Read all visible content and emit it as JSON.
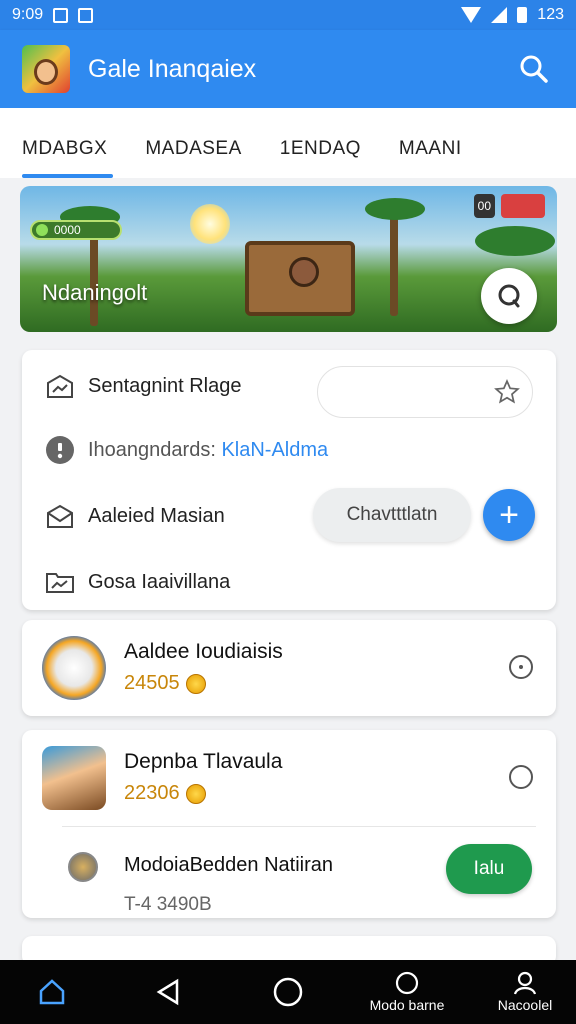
{
  "status_bar": {
    "time": "9:09",
    "battery": "123"
  },
  "app_bar": {
    "title": "Gale Inanqaiex"
  },
  "tabs": [
    {
      "label": "MDABGX",
      "active": true
    },
    {
      "label": "MADASEA",
      "active": false
    },
    {
      "label": "1ENDAQ",
      "active": false
    },
    {
      "label": "MAANI",
      "active": false
    }
  ],
  "banner": {
    "title": "Ndaningolt",
    "pill": "0000",
    "badge": "00"
  },
  "settings": {
    "rows": [
      {
        "label": "Sentagnint Rlage",
        "icon": "house-chart-icon"
      },
      {
        "label": "Ihoangndards:",
        "link": "KlaN-Aldma",
        "icon": "info-icon"
      },
      {
        "label": "Aaleied Masian",
        "icon": "mail-open-icon"
      },
      {
        "label": "Gosa Iaaivillana",
        "icon": "folder-chart-icon"
      }
    ],
    "secondary_button": "Chavtttlatn",
    "add_button": "+"
  },
  "players": [
    {
      "name": "Aaldee Ioudiaisis",
      "score": "24505"
    },
    {
      "name": "Depnba Tlavaula",
      "score": "22306"
    }
  ],
  "sub_item": {
    "name": "ModoiaBedden Natiiran",
    "action": "Ialu",
    "meta": "T-4 3490B"
  },
  "nav": [
    {
      "icon": "home-icon",
      "label": ""
    },
    {
      "icon": "back-icon",
      "label": ""
    },
    {
      "icon": "circle-home-icon",
      "label": ""
    },
    {
      "icon": "mode-icon",
      "label": "Modo barne"
    },
    {
      "icon": "profile-icon",
      "label": "Nacoolel"
    }
  ],
  "colors": {
    "primary": "#2f8af0",
    "accent_green": "#1f9a4e",
    "score": "#c8860a"
  }
}
